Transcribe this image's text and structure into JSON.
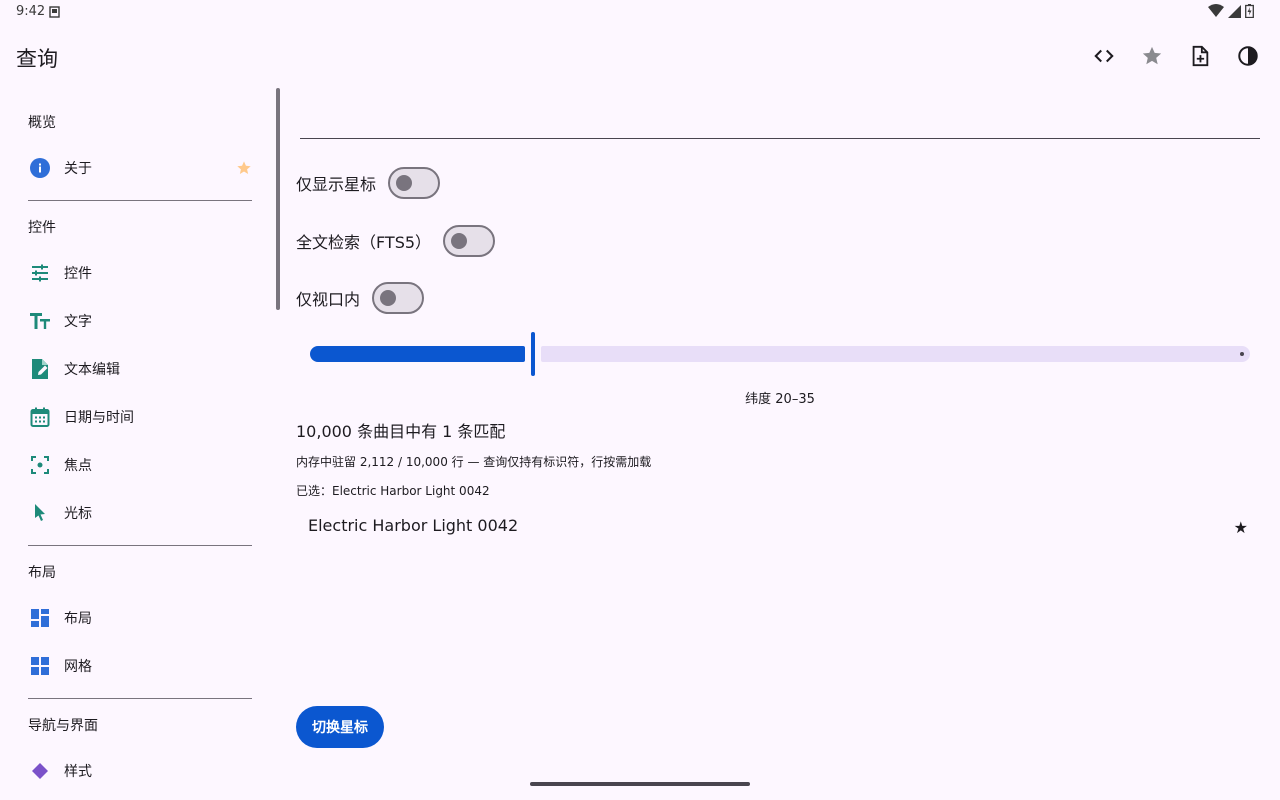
{
  "status": {
    "time": "9:42"
  },
  "app_bar": {
    "title": "查询"
  },
  "sidebar": {
    "sections": [
      {
        "header": "概览"
      },
      {
        "header": "控件"
      },
      {
        "header": "布局"
      },
      {
        "header": "导航与界面"
      }
    ],
    "items": [
      {
        "label": "关于"
      },
      {
        "label": "控件"
      },
      {
        "label": "文字"
      },
      {
        "label": "文本编辑"
      },
      {
        "label": "日期与时间"
      },
      {
        "label": "焦点"
      },
      {
        "label": "光标"
      },
      {
        "label": "布局"
      },
      {
        "label": "网格"
      },
      {
        "label": "样式"
      }
    ]
  },
  "toggles": [
    {
      "label": "仅显示星标",
      "checked": false
    },
    {
      "label": "全文检索（FTS5）",
      "checked": false
    },
    {
      "label": "仅视口内",
      "checked": false
    }
  ],
  "slider": {
    "value_fraction": 0.235,
    "caption": "纬度 20–35"
  },
  "results": {
    "count_text": "10,000 条曲目中有 1 条匹配",
    "memory_text": "内存中驻留 2,112 / 10,000 行 — 查询仅持有标识符，行按需加载",
    "selected_text": "已选：Electric Harbor Light 0042",
    "rows": [
      {
        "title": "Electric Harbor Light 0042",
        "star": "★"
      }
    ]
  },
  "fab": {
    "label": "切换星标"
  },
  "colors": {
    "primary": "#0b57d0",
    "background": "#fdf7ff",
    "teal_icon": "#1e8a7a",
    "blue_icon": "#2f6ed8",
    "star_inactive": "#ffc98b"
  },
  "icons": {
    "app_bar": [
      "code-icon",
      "star-icon",
      "note-add-icon",
      "contrast-icon"
    ],
    "sidebar": [
      "info-icon",
      "tune-icon",
      "text-fields-icon",
      "edit-document-icon",
      "calendar-icon",
      "center-focus-icon",
      "cursor-arrow-icon",
      "dashboard-icon",
      "grid-icon",
      "style-icon"
    ]
  }
}
